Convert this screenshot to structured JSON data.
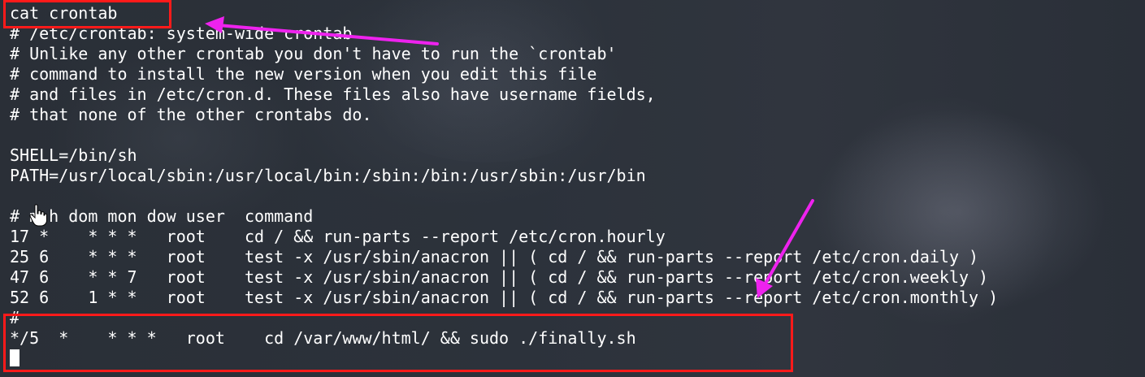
{
  "terminal": {
    "lines": {
      "l1": "cat crontab",
      "l2": "# /etc/crontab: system-wide crontab",
      "l3": "# Unlike any other crontab you don't have to run the `crontab'",
      "l4": "# command to install the new version when you edit this file",
      "l5": "# and files in /etc/cron.d. These files also have username fields,",
      "l6": "# that none of the other crontabs do.",
      "l7": "",
      "l8": "SHELL=/bin/sh",
      "l9": "PATH=/usr/local/sbin:/usr/local/bin:/sbin:/bin:/usr/sbin:/usr/bin",
      "l10": "",
      "l11": "# m h dom mon dow user  command",
      "l12": "17 *    * * *   root    cd / && run-parts --report /etc/cron.hourly",
      "l13": "25 6    * * *   root    test -x /usr/sbin/anacron || ( cd / && run-parts --report /etc/cron.daily )",
      "l14": "47 6    * * 7   root    test -x /usr/sbin/anacron || ( cd / && run-parts --report /etc/cron.weekly )",
      "l15": "52 6    1 * *   root    test -x /usr/sbin/anacron || ( cd / && run-parts --report /etc/cron.monthly )",
      "l16": "#",
      "l17": "*/5  *    * * *   root    cd /var/www/html/ && sudo ./finally.sh"
    }
  },
  "annotations": {
    "highlight_color": "#ff1a1a",
    "arrow_color": "#ee22ee"
  }
}
